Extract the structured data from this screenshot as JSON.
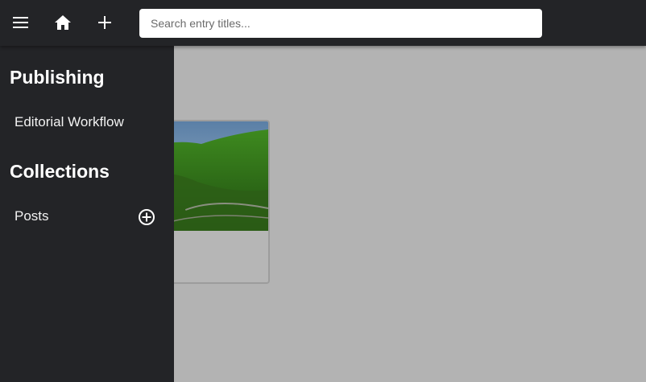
{
  "topbar": {
    "menu_icon": "hamburger-menu-icon",
    "home_icon": "home-icon",
    "add_icon": "plus-icon",
    "search": {
      "placeholder": "Search entry titles...",
      "value": ""
    }
  },
  "sidebar": {
    "publishing_heading": "Publishing",
    "workflow_label": "Editorial Workflow",
    "collections_heading": "Collections",
    "posts_label": "Posts",
    "posts_add_icon": "circle-plus-icon"
  },
  "main": {
    "card_image": "landscape-thumbnail"
  },
  "colors": {
    "topbar_bg": "#232427",
    "sidebar_bg": "#232427",
    "overlay_bg": "#b3b3b3",
    "text": "#ffffff"
  }
}
